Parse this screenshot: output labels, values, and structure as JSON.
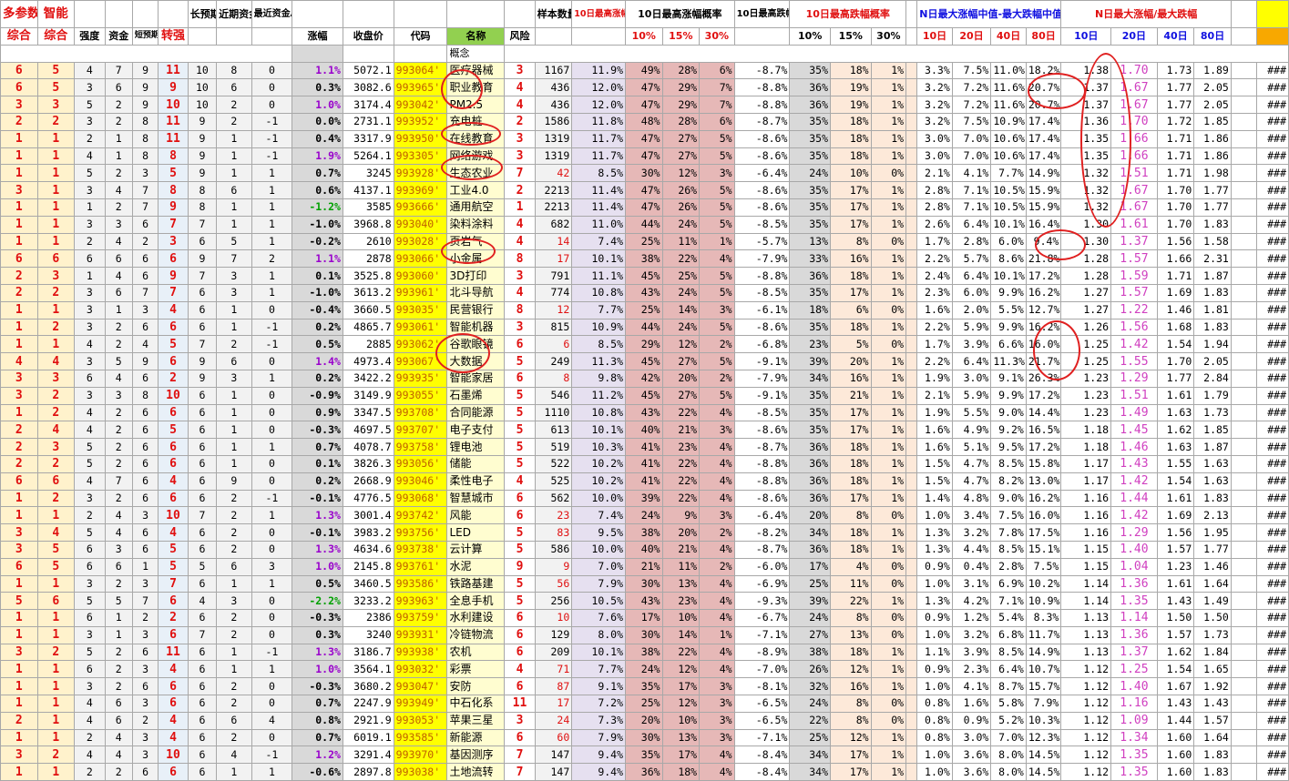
{
  "header": {
    "row1": {
      "c0": "多参数",
      "c1": "智能",
      "c5": "",
      "c6": "长预期",
      "c7": "近期资金",
      "c8": "最近资金A",
      "c13": "",
      "c14": "样本数量",
      "c15": "10日最高涨幅均值",
      "c16_18": "10日最高涨幅概率",
      "c20": "10日最高跌幅均值",
      "c21_23": "10日最高跌幅概率",
      "c25_28": "N日最大涨幅中值-最大跌幅中值",
      "c29_32": "N日最大涨幅/最大跌幅"
    },
    "row2": {
      "c0": "综合",
      "c1": "综合",
      "c2": "强度",
      "c3": "资金",
      "c4": "短预期",
      "c5": "转强",
      "c9": "涨幅",
      "c10": "收盘价",
      "c11": "代码",
      "c12": "名称",
      "c13": "风险",
      "c16": "10%",
      "c17": "15%",
      "c18": "30%",
      "c21": "10%",
      "c22": "15%",
      "c23": "30%",
      "c25": "10日",
      "c26": "20日",
      "c27": "40日",
      "c28": "80日",
      "c29": "10日",
      "c30": "20日",
      "c31": "40日",
      "c32": "80日"
    },
    "concept_label": "概念"
  },
  "rows": [
    [
      "6",
      "5",
      "4",
      "7",
      "9",
      "11",
      "10",
      "8",
      "0",
      "1.1%",
      "5072.1",
      "993064'",
      "医疗器械",
      "3",
      "1167",
      "11.9%",
      "49%",
      "28%",
      "6%",
      "-8.7%",
      "35%",
      "18%",
      "1%",
      "3.3%",
      "7.5%",
      "11.0%",
      "18.2%",
      "1.38",
      "1.70",
      "1.73",
      "1.89",
      "###"
    ],
    [
      "6",
      "5",
      "3",
      "6",
      "9",
      "9",
      "10",
      "6",
      "0",
      "0.3%",
      "3082.6",
      "993965'",
      "职业教育",
      "4",
      "436",
      "12.0%",
      "47%",
      "29%",
      "7%",
      "-8.8%",
      "36%",
      "19%",
      "1%",
      "3.2%",
      "7.2%",
      "11.6%",
      "20.7%",
      "1.37",
      "1.67",
      "1.77",
      "2.05",
      "###"
    ],
    [
      "3",
      "3",
      "5",
      "2",
      "9",
      "10",
      "10",
      "2",
      "0",
      "1.0%",
      "3174.4",
      "993042'",
      "PM2.5",
      "4",
      "436",
      "12.0%",
      "47%",
      "29%",
      "7%",
      "-8.8%",
      "36%",
      "19%",
      "1%",
      "3.2%",
      "7.2%",
      "11.6%",
      "20.7%",
      "1.37",
      "1.67",
      "1.77",
      "2.05",
      "###"
    ],
    [
      "2",
      "2",
      "3",
      "2",
      "8",
      "11",
      "9",
      "2",
      "-1",
      "0.0%",
      "2731.1",
      "993952'",
      "充电桩",
      "2",
      "1586",
      "11.8%",
      "48%",
      "28%",
      "6%",
      "-8.7%",
      "35%",
      "18%",
      "1%",
      "3.2%",
      "7.5%",
      "10.9%",
      "17.4%",
      "1.36",
      "1.70",
      "1.72",
      "1.85",
      "###"
    ],
    [
      "1",
      "1",
      "2",
      "1",
      "8",
      "11",
      "9",
      "1",
      "-1",
      "0.4%",
      "3317.9",
      "993950'",
      "在线教育",
      "3",
      "1319",
      "11.7%",
      "47%",
      "27%",
      "5%",
      "-8.6%",
      "35%",
      "18%",
      "1%",
      "3.0%",
      "7.0%",
      "10.6%",
      "17.4%",
      "1.35",
      "1.66",
      "1.71",
      "1.86",
      "###"
    ],
    [
      "1",
      "1",
      "4",
      "1",
      "8",
      "8",
      "9",
      "1",
      "-1",
      "1.9%",
      "5264.1",
      "993305'",
      "网络游戏",
      "3",
      "1319",
      "11.7%",
      "47%",
      "27%",
      "5%",
      "-8.6%",
      "35%",
      "18%",
      "1%",
      "3.0%",
      "7.0%",
      "10.6%",
      "17.4%",
      "1.35",
      "1.66",
      "1.71",
      "1.86",
      "###"
    ],
    [
      "1",
      "1",
      "5",
      "2",
      "3",
      "5",
      "9",
      "1",
      "1",
      "0.7%",
      "3245",
      "993928'",
      "生态农业",
      "7",
      "42",
      "8.5%",
      "30%",
      "12%",
      "3%",
      "-6.4%",
      "24%",
      "10%",
      "0%",
      "2.1%",
      "4.1%",
      "7.7%",
      "14.9%",
      "1.32",
      "1.51",
      "1.71",
      "1.98",
      "###"
    ],
    [
      "3",
      "1",
      "3",
      "4",
      "7",
      "8",
      "8",
      "6",
      "1",
      "0.6%",
      "4137.1",
      "993969'",
      "工业4.0",
      "2",
      "2213",
      "11.4%",
      "47%",
      "26%",
      "5%",
      "-8.6%",
      "35%",
      "17%",
      "1%",
      "2.8%",
      "7.1%",
      "10.5%",
      "15.9%",
      "1.32",
      "1.67",
      "1.70",
      "1.77",
      "###"
    ],
    [
      "1",
      "1",
      "1",
      "2",
      "7",
      "9",
      "8",
      "1",
      "1",
      "-1.2%",
      "3585",
      "993666'",
      "通用航空",
      "1",
      "2213",
      "11.4%",
      "47%",
      "26%",
      "5%",
      "-8.6%",
      "35%",
      "17%",
      "1%",
      "2.8%",
      "7.1%",
      "10.5%",
      "15.9%",
      "1.32",
      "1.67",
      "1.70",
      "1.77",
      "###"
    ],
    [
      "1",
      "1",
      "3",
      "3",
      "6",
      "7",
      "7",
      "1",
      "1",
      "-1.0%",
      "3968.8",
      "993040'",
      "染料涂料",
      "4",
      "682",
      "11.0%",
      "44%",
      "24%",
      "5%",
      "-8.5%",
      "35%",
      "17%",
      "1%",
      "2.6%",
      "6.4%",
      "10.1%",
      "16.4%",
      "1.30",
      "1.61",
      "1.70",
      "1.83",
      "###"
    ],
    [
      "1",
      "1",
      "2",
      "4",
      "2",
      "3",
      "6",
      "5",
      "1",
      "-0.2%",
      "2610",
      "993028'",
      "页岩气",
      "4",
      "14",
      "7.4%",
      "25%",
      "11%",
      "1%",
      "-5.7%",
      "13%",
      "8%",
      "0%",
      "1.7%",
      "2.8%",
      "6.0%",
      "9.4%",
      "1.30",
      "1.37",
      "1.56",
      "1.58",
      "###"
    ],
    [
      "6",
      "6",
      "6",
      "6",
      "6",
      "6",
      "9",
      "7",
      "2",
      "1.1%",
      "2878",
      "993066'",
      "小金属",
      "8",
      "17",
      "10.1%",
      "38%",
      "22%",
      "4%",
      "-7.9%",
      "33%",
      "16%",
      "1%",
      "2.2%",
      "5.7%",
      "8.6%",
      "21.8%",
      "1.28",
      "1.57",
      "1.66",
      "2.31",
      "###"
    ],
    [
      "2",
      "3",
      "1",
      "4",
      "6",
      "9",
      "7",
      "3",
      "1",
      "0.1%",
      "3525.8",
      "993060'",
      "3D打印",
      "3",
      "791",
      "11.1%",
      "45%",
      "25%",
      "5%",
      "-8.8%",
      "36%",
      "18%",
      "1%",
      "2.4%",
      "6.4%",
      "10.1%",
      "17.2%",
      "1.28",
      "1.59",
      "1.71",
      "1.87",
      "###"
    ],
    [
      "2",
      "2",
      "3",
      "6",
      "7",
      "7",
      "6",
      "3",
      "1",
      "-1.0%",
      "3613.2",
      "993961'",
      "北斗导航",
      "4",
      "774",
      "10.8%",
      "43%",
      "24%",
      "5%",
      "-8.5%",
      "35%",
      "17%",
      "1%",
      "2.3%",
      "6.0%",
      "9.9%",
      "16.2%",
      "1.27",
      "1.57",
      "1.69",
      "1.83",
      "###"
    ],
    [
      "1",
      "1",
      "3",
      "1",
      "3",
      "4",
      "6",
      "1",
      "0",
      "-0.4%",
      "3660.5",
      "993035'",
      "民营银行",
      "8",
      "12",
      "7.7%",
      "25%",
      "14%",
      "3%",
      "-6.1%",
      "18%",
      "6%",
      "0%",
      "1.6%",
      "2.0%",
      "5.5%",
      "12.7%",
      "1.27",
      "1.22",
      "1.46",
      "1.81",
      "###"
    ],
    [
      "1",
      "2",
      "3",
      "2",
      "6",
      "6",
      "6",
      "1",
      "-1",
      "0.2%",
      "4865.7",
      "993061'",
      "智能机器",
      "3",
      "815",
      "10.9%",
      "44%",
      "24%",
      "5%",
      "-8.6%",
      "35%",
      "18%",
      "1%",
      "2.2%",
      "5.9%",
      "9.9%",
      "16.2%",
      "1.26",
      "1.56",
      "1.68",
      "1.83",
      "###"
    ],
    [
      "1",
      "1",
      "4",
      "2",
      "4",
      "5",
      "7",
      "2",
      "-1",
      "0.5%",
      "2885",
      "993062'",
      "谷歌眼镜",
      "6",
      "6",
      "8.5%",
      "29%",
      "12%",
      "2%",
      "-6.8%",
      "23%",
      "5%",
      "0%",
      "1.7%",
      "3.9%",
      "6.6%",
      "16.0%",
      "1.25",
      "1.42",
      "1.54",
      "1.94",
      "###"
    ],
    [
      "4",
      "4",
      "3",
      "5",
      "9",
      "6",
      "9",
      "6",
      "0",
      "1.4%",
      "4973.4",
      "993067'",
      "大数据",
      "5",
      "249",
      "11.3%",
      "45%",
      "27%",
      "5%",
      "-9.1%",
      "39%",
      "20%",
      "1%",
      "2.2%",
      "6.4%",
      "11.3%",
      "21.7%",
      "1.25",
      "1.55",
      "1.70",
      "2.05",
      "###"
    ],
    [
      "3",
      "3",
      "6",
      "4",
      "6",
      "2",
      "9",
      "3",
      "1",
      "0.2%",
      "3422.2",
      "993935'",
      "智能家居",
      "6",
      "8",
      "9.8%",
      "42%",
      "20%",
      "2%",
      "-7.9%",
      "34%",
      "16%",
      "1%",
      "1.9%",
      "3.0%",
      "9.1%",
      "26.3%",
      "1.23",
      "1.29",
      "1.77",
      "2.84",
      "###"
    ],
    [
      "3",
      "2",
      "3",
      "3",
      "8",
      "10",
      "6",
      "1",
      "0",
      "-0.9%",
      "3149.9",
      "993055'",
      "石墨烯",
      "5",
      "546",
      "11.2%",
      "45%",
      "27%",
      "5%",
      "-9.1%",
      "35%",
      "21%",
      "1%",
      "2.1%",
      "5.9%",
      "9.9%",
      "17.2%",
      "1.23",
      "1.51",
      "1.61",
      "1.79",
      "###"
    ],
    [
      "1",
      "2",
      "4",
      "2",
      "6",
      "6",
      "6",
      "1",
      "0",
      "0.9%",
      "3347.5",
      "993708'",
      "合同能源",
      "5",
      "1110",
      "10.8%",
      "43%",
      "22%",
      "4%",
      "-8.5%",
      "35%",
      "17%",
      "1%",
      "1.9%",
      "5.5%",
      "9.0%",
      "14.4%",
      "1.23",
      "1.49",
      "1.63",
      "1.73",
      "###"
    ],
    [
      "2",
      "4",
      "4",
      "2",
      "6",
      "5",
      "6",
      "1",
      "0",
      "-0.3%",
      "4697.5",
      "993707'",
      "电子支付",
      "5",
      "613",
      "10.1%",
      "40%",
      "21%",
      "3%",
      "-8.6%",
      "35%",
      "17%",
      "1%",
      "1.6%",
      "4.9%",
      "9.2%",
      "16.5%",
      "1.18",
      "1.45",
      "1.62",
      "1.85",
      "###"
    ],
    [
      "2",
      "3",
      "5",
      "2",
      "6",
      "6",
      "6",
      "1",
      "1",
      "0.7%",
      "4078.7",
      "993758'",
      "锂电池",
      "5",
      "519",
      "10.3%",
      "41%",
      "23%",
      "4%",
      "-8.7%",
      "36%",
      "18%",
      "1%",
      "1.6%",
      "5.1%",
      "9.5%",
      "17.2%",
      "1.18",
      "1.46",
      "1.63",
      "1.87",
      "###"
    ],
    [
      "2",
      "2",
      "5",
      "2",
      "6",
      "6",
      "6",
      "1",
      "0",
      "0.1%",
      "3826.3",
      "993056'",
      "储能",
      "5",
      "522",
      "10.2%",
      "41%",
      "22%",
      "4%",
      "-8.8%",
      "36%",
      "18%",
      "1%",
      "1.5%",
      "4.7%",
      "8.5%",
      "15.8%",
      "1.17",
      "1.43",
      "1.55",
      "1.63",
      "###"
    ],
    [
      "6",
      "6",
      "4",
      "7",
      "6",
      "4",
      "6",
      "9",
      "0",
      "0.2%",
      "2668.9",
      "993046'",
      "柔性电子",
      "4",
      "525",
      "10.2%",
      "41%",
      "22%",
      "4%",
      "-8.8%",
      "36%",
      "18%",
      "1%",
      "1.5%",
      "4.7%",
      "8.2%",
      "13.0%",
      "1.17",
      "1.42",
      "1.54",
      "1.63",
      "###"
    ],
    [
      "1",
      "2",
      "3",
      "2",
      "6",
      "6",
      "6",
      "2",
      "-1",
      "-0.1%",
      "4776.5",
      "993068'",
      "智慧城市",
      "6",
      "562",
      "10.0%",
      "39%",
      "22%",
      "4%",
      "-8.6%",
      "36%",
      "17%",
      "1%",
      "1.4%",
      "4.8%",
      "9.0%",
      "16.2%",
      "1.16",
      "1.44",
      "1.61",
      "1.83",
      "###"
    ],
    [
      "1",
      "1",
      "2",
      "4",
      "3",
      "10",
      "7",
      "2",
      "1",
      "1.3%",
      "3001.4",
      "993742'",
      "风能",
      "6",
      "23",
      "7.4%",
      "24%",
      "9%",
      "3%",
      "-6.4%",
      "20%",
      "8%",
      "0%",
      "1.0%",
      "3.4%",
      "7.5%",
      "16.0%",
      "1.16",
      "1.42",
      "1.69",
      "2.13",
      "###"
    ],
    [
      "3",
      "4",
      "5",
      "4",
      "6",
      "4",
      "6",
      "2",
      "0",
      "-0.1%",
      "3983.2",
      "993756'",
      "LED",
      "5",
      "83",
      "9.5%",
      "38%",
      "20%",
      "2%",
      "-8.2%",
      "34%",
      "18%",
      "1%",
      "1.3%",
      "3.2%",
      "7.8%",
      "17.5%",
      "1.16",
      "1.29",
      "1.56",
      "1.95",
      "###"
    ],
    [
      "3",
      "5",
      "6",
      "3",
      "6",
      "5",
      "6",
      "2",
      "0",
      "1.3%",
      "4634.6",
      "993738'",
      "云计算",
      "5",
      "586",
      "10.0%",
      "40%",
      "21%",
      "4%",
      "-8.7%",
      "36%",
      "18%",
      "1%",
      "1.3%",
      "4.4%",
      "8.5%",
      "15.1%",
      "1.15",
      "1.40",
      "1.57",
      "1.77",
      "###"
    ],
    [
      "6",
      "5",
      "6",
      "6",
      "1",
      "5",
      "5",
      "6",
      "3",
      "1.0%",
      "2145.8",
      "993761'",
      "水泥",
      "9",
      "9",
      "7.0%",
      "21%",
      "11%",
      "2%",
      "-6.0%",
      "17%",
      "4%",
      "0%",
      "0.9%",
      "0.4%",
      "2.8%",
      "7.5%",
      "1.15",
      "1.04",
      "1.23",
      "1.46",
      "###"
    ],
    [
      "1",
      "1",
      "3",
      "2",
      "3",
      "7",
      "6",
      "1",
      "1",
      "0.5%",
      "3460.5",
      "993586'",
      "铁路基建",
      "5",
      "56",
      "7.9%",
      "30%",
      "13%",
      "4%",
      "-6.9%",
      "25%",
      "11%",
      "0%",
      "1.0%",
      "3.1%",
      "6.9%",
      "10.2%",
      "1.14",
      "1.36",
      "1.61",
      "1.64",
      "###"
    ],
    [
      "5",
      "6",
      "5",
      "5",
      "7",
      "6",
      "4",
      "3",
      "0",
      "-2.2%",
      "3233.2",
      "993963'",
      "全息手机",
      "5",
      "256",
      "10.5%",
      "43%",
      "23%",
      "4%",
      "-9.3%",
      "39%",
      "22%",
      "1%",
      "1.3%",
      "4.2%",
      "7.1%",
      "10.9%",
      "1.14",
      "1.35",
      "1.43",
      "1.49",
      "###"
    ],
    [
      "1",
      "1",
      "6",
      "1",
      "2",
      "2",
      "6",
      "2",
      "0",
      "-0.3%",
      "2386",
      "993759'",
      "水利建设",
      "6",
      "10",
      "7.6%",
      "17%",
      "10%",
      "4%",
      "-6.7%",
      "24%",
      "8%",
      "0%",
      "0.9%",
      "1.2%",
      "5.4%",
      "8.3%",
      "1.13",
      "1.14",
      "1.50",
      "1.50",
      "###"
    ],
    [
      "1",
      "1",
      "3",
      "1",
      "3",
      "6",
      "7",
      "2",
      "0",
      "0.3%",
      "3240",
      "993931'",
      "冷链物流",
      "6",
      "129",
      "8.0%",
      "30%",
      "14%",
      "1%",
      "-7.1%",
      "27%",
      "13%",
      "0%",
      "1.0%",
      "3.2%",
      "6.8%",
      "11.7%",
      "1.13",
      "1.36",
      "1.57",
      "1.73",
      "###"
    ],
    [
      "3",
      "2",
      "5",
      "2",
      "6",
      "11",
      "6",
      "1",
      "-1",
      "1.3%",
      "3186.7",
      "993938'",
      "农机",
      "6",
      "209",
      "10.1%",
      "38%",
      "22%",
      "4%",
      "-8.9%",
      "38%",
      "18%",
      "1%",
      "1.1%",
      "3.9%",
      "8.5%",
      "14.9%",
      "1.13",
      "1.37",
      "1.62",
      "1.84",
      "###"
    ],
    [
      "1",
      "1",
      "6",
      "2",
      "3",
      "4",
      "6",
      "1",
      "1",
      "1.0%",
      "3564.1",
      "993032'",
      "彩票",
      "4",
      "71",
      "7.7%",
      "24%",
      "12%",
      "4%",
      "-7.0%",
      "26%",
      "12%",
      "1%",
      "0.9%",
      "2.3%",
      "6.4%",
      "10.7%",
      "1.12",
      "1.25",
      "1.54",
      "1.65",
      "###"
    ],
    [
      "1",
      "1",
      "3",
      "2",
      "6",
      "6",
      "6",
      "2",
      "0",
      "-0.3%",
      "3680.2",
      "993047'",
      "安防",
      "6",
      "87",
      "9.1%",
      "35%",
      "17%",
      "3%",
      "-8.1%",
      "32%",
      "16%",
      "1%",
      "1.0%",
      "4.1%",
      "8.7%",
      "15.7%",
      "1.12",
      "1.40",
      "1.67",
      "1.92",
      "###"
    ],
    [
      "1",
      "1",
      "4",
      "6",
      "3",
      "6",
      "6",
      "2",
      "0",
      "0.7%",
      "2247.9",
      "993949'",
      "中石化系",
      "11",
      "17",
      "7.2%",
      "25%",
      "12%",
      "3%",
      "-6.5%",
      "24%",
      "8%",
      "0%",
      "0.8%",
      "1.6%",
      "5.8%",
      "7.9%",
      "1.12",
      "1.16",
      "1.43",
      "1.43",
      "###"
    ],
    [
      "2",
      "1",
      "4",
      "6",
      "2",
      "4",
      "6",
      "6",
      "4",
      "0.8%",
      "2921.9",
      "993053'",
      "苹果三星",
      "3",
      "24",
      "7.3%",
      "20%",
      "10%",
      "3%",
      "-6.5%",
      "22%",
      "8%",
      "0%",
      "0.8%",
      "0.9%",
      "5.2%",
      "10.3%",
      "1.12",
      "1.09",
      "1.44",
      "1.57",
      "###"
    ],
    [
      "1",
      "1",
      "2",
      "4",
      "3",
      "4",
      "6",
      "2",
      "0",
      "0.7%",
      "6019.1",
      "993585'",
      "新能源",
      "6",
      "60",
      "7.9%",
      "30%",
      "13%",
      "3%",
      "-7.1%",
      "25%",
      "12%",
      "1%",
      "0.8%",
      "3.0%",
      "7.0%",
      "12.3%",
      "1.12",
      "1.34",
      "1.60",
      "1.64",
      "###"
    ],
    [
      "3",
      "2",
      "4",
      "4",
      "3",
      "10",
      "6",
      "4",
      "-1",
      "1.2%",
      "3291.4",
      "993970'",
      "基因测序",
      "7",
      "147",
      "9.4%",
      "35%",
      "17%",
      "4%",
      "-8.4%",
      "34%",
      "17%",
      "1%",
      "1.0%",
      "3.6%",
      "8.0%",
      "14.5%",
      "1.12",
      "1.35",
      "1.60",
      "1.83",
      "###"
    ],
    [
      "1",
      "1",
      "2",
      "2",
      "6",
      "6",
      "6",
      "1",
      "1",
      "-0.6%",
      "2897.8",
      "993038'",
      "土地流转",
      "7",
      "147",
      "9.4%",
      "36%",
      "18%",
      "4%",
      "-8.4%",
      "34%",
      "17%",
      "1%",
      "1.0%",
      "3.6%",
      "8.0%",
      "14.5%",
      "1.12",
      "1.35",
      "1.60",
      "1.83",
      "###"
    ]
  ]
}
